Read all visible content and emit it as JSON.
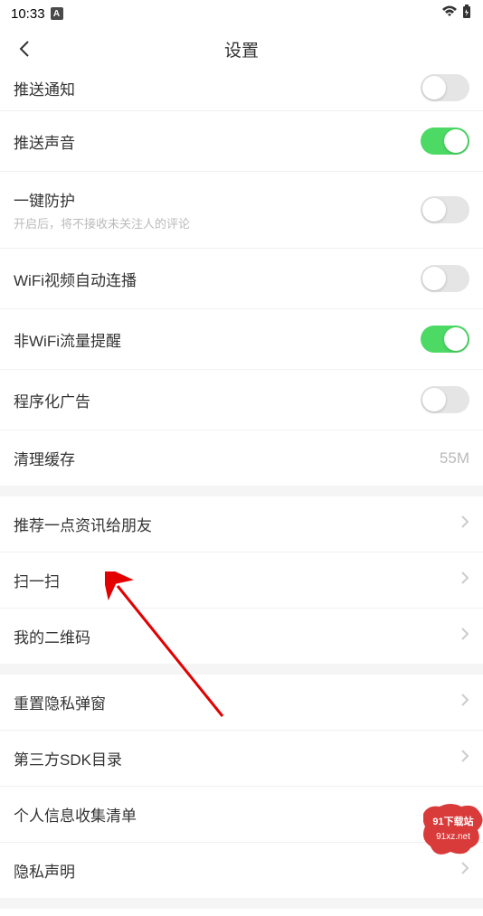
{
  "status": {
    "time": "10:33",
    "badge": "A"
  },
  "header": {
    "title": "设置"
  },
  "sections": [
    {
      "rows": [
        {
          "label": "推送通知",
          "type": "toggle",
          "on": false,
          "partial": true
        },
        {
          "label": "推送声音",
          "type": "toggle",
          "on": true
        },
        {
          "label": "一键防护",
          "sublabel": "开启后，将不接收未关注人的评论",
          "type": "toggle",
          "on": false
        },
        {
          "label": "WiFi视频自动连播",
          "type": "toggle",
          "on": false
        },
        {
          "label": "非WiFi流量提醒",
          "type": "toggle",
          "on": true
        },
        {
          "label": "程序化广告",
          "type": "toggle",
          "on": false
        },
        {
          "label": "清理缓存",
          "type": "value",
          "value": "55M"
        }
      ]
    },
    {
      "rows": [
        {
          "label": "推荐一点资讯给朋友",
          "type": "nav"
        },
        {
          "label": "扫一扫",
          "type": "nav"
        },
        {
          "label": "我的二维码",
          "type": "nav"
        }
      ]
    },
    {
      "rows": [
        {
          "label": "重置隐私弹窗",
          "type": "nav"
        },
        {
          "label": "第三方SDK目录",
          "type": "nav"
        },
        {
          "label": "个人信息收集清单",
          "type": "nav"
        },
        {
          "label": "隐私声明",
          "type": "nav"
        }
      ]
    }
  ],
  "watermark": {
    "top": "91下载站",
    "domain": "91xz.net"
  }
}
